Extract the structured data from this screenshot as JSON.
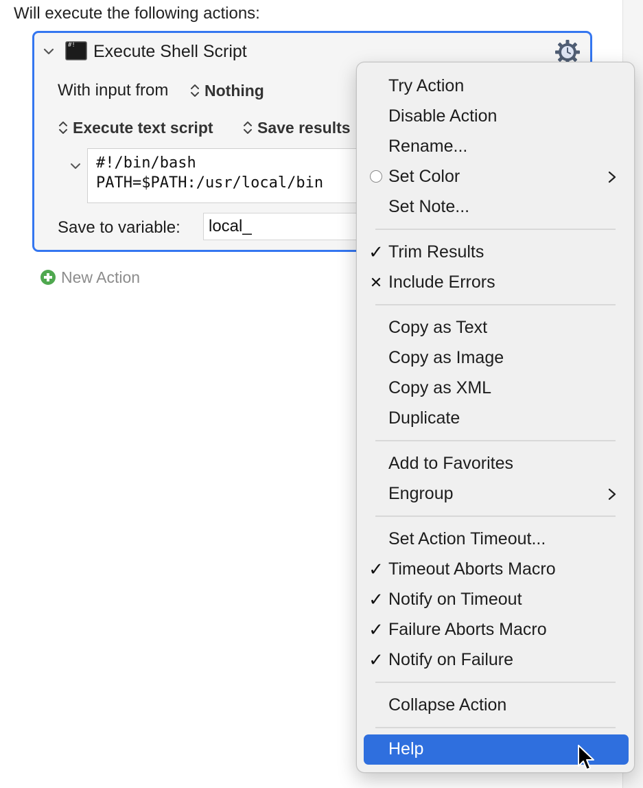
{
  "header": {
    "text": "Will execute the following actions:"
  },
  "action": {
    "title": "Execute Shell Script",
    "input_label": "With input from",
    "input_value": "Nothing",
    "script_mode": "Execute text script",
    "results_mode": "Save results",
    "script_lines": "#!/bin/bash\nPATH=$PATH:/usr/local/bin",
    "save_label": "Save to variable:",
    "save_value": "local_"
  },
  "new_action": {
    "label": "New Action"
  },
  "menu": {
    "try_action": "Try Action",
    "disable_action": "Disable Action",
    "rename": "Rename...",
    "set_color": "Set Color",
    "set_note": "Set Note...",
    "trim_results": "Trim Results",
    "include_errors": "Include Errors",
    "copy_as_text": "Copy as Text",
    "copy_as_image": "Copy as Image",
    "copy_as_xml": "Copy as XML",
    "duplicate": "Duplicate",
    "add_to_favorites": "Add to Favorites",
    "engroup": "Engroup",
    "set_action_timeout": "Set Action Timeout...",
    "timeout_aborts_macro": "Timeout Aborts Macro",
    "notify_on_timeout": "Notify on Timeout",
    "failure_aborts_macro": "Failure Aborts Macro",
    "notify_on_failure": "Notify on Failure",
    "collapse_action": "Collapse Action",
    "help": "Help",
    "check_mark": "✓",
    "x_mark": "✕"
  },
  "colors": {
    "accent_blue": "#3476f0",
    "menu_highlight": "#2f6fde",
    "plus_green": "#4fa84f"
  }
}
